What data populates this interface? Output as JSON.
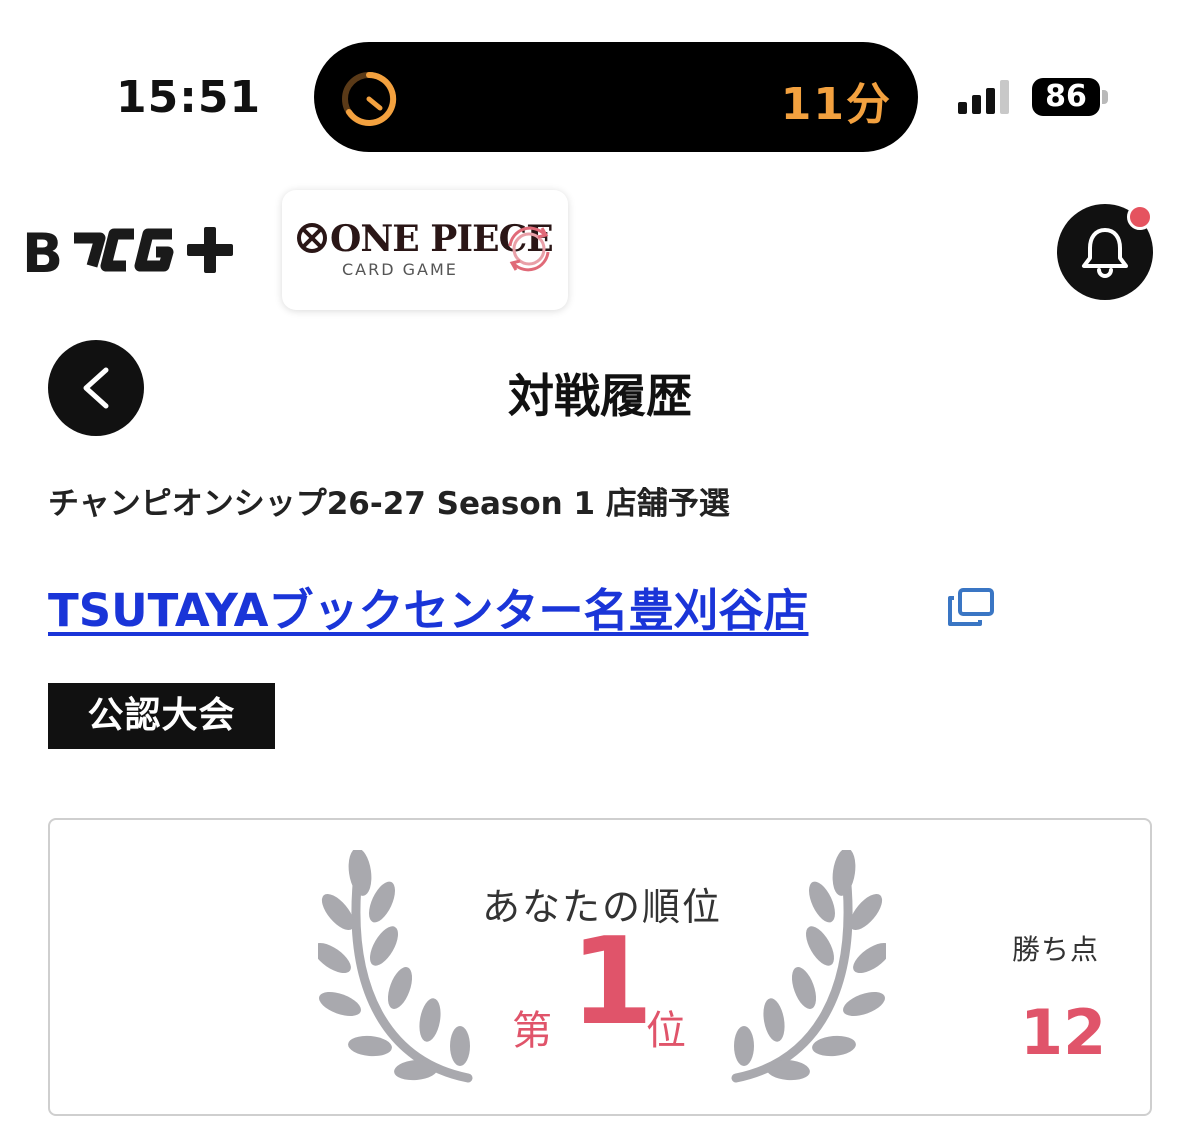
{
  "status_bar": {
    "time": "15:51",
    "activity_text": "11分",
    "battery": "86"
  },
  "header": {
    "app_logo": "B-TCG+",
    "game_logo_title": "ONE PIECE",
    "game_logo_subtitle": "CARD GAME"
  },
  "page": {
    "title": "対戦履歴"
  },
  "event": {
    "name": "チャンピオンシップ26-27 Season 1 店舗予選",
    "store": "TSUTAYAブックセンター名豊刈谷店",
    "tag": "公認大会"
  },
  "result": {
    "rank_label": "あなたの順位",
    "rank_prefix": "第",
    "rank": "1",
    "rank_suffix": "位",
    "points_label": "勝ち点",
    "points": "12"
  },
  "colors": {
    "accent": "#e0546a",
    "link": "#1a35d8",
    "activity": "#f3a13f",
    "dark": "#111111"
  },
  "icons": [
    "timer-icon",
    "signal-icon",
    "battery-icon",
    "bell-icon",
    "back-arrow-icon",
    "external-link-icon",
    "laurel-icon"
  ]
}
